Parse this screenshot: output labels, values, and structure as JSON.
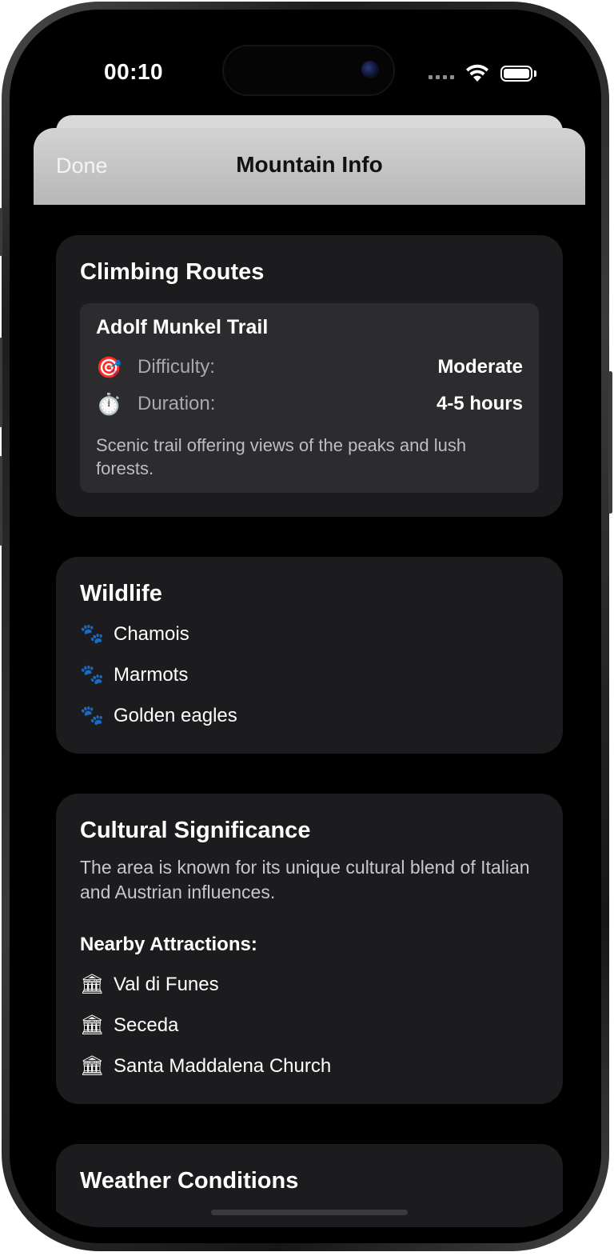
{
  "status_bar": {
    "time": "00:10"
  },
  "sheet": {
    "done_label": "Done",
    "title": "Mountain Info"
  },
  "climbing_routes": {
    "title": "Climbing Routes",
    "routes": [
      {
        "name": "Adolf Munkel Trail",
        "difficulty_icon": "🎯",
        "difficulty_label": "Difficulty:",
        "difficulty_value": "Moderate",
        "duration_icon": "⏱️",
        "duration_label": "Duration:",
        "duration_value": "4-5 hours",
        "description": "Scenic trail offering views of the peaks and lush forests."
      }
    ]
  },
  "wildlife": {
    "title": "Wildlife",
    "icon": "🐾",
    "items": [
      "Chamois",
      "Marmots",
      "Golden eagles"
    ]
  },
  "cultural": {
    "title": "Cultural Significance",
    "description": "The area is known for its unique cultural blend of Italian and Austrian influences.",
    "attractions_heading": "Nearby Attractions:",
    "icon": "🏛",
    "attractions": [
      "Val di Funes",
      "Seceda",
      "Santa Maddalena Church"
    ]
  },
  "weather": {
    "title": "Weather Conditions"
  }
}
